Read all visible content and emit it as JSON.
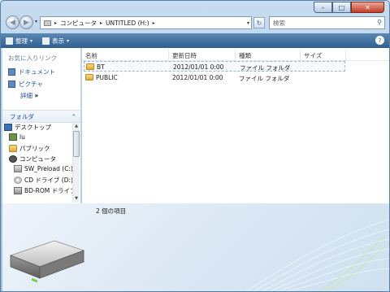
{
  "window": {
    "min_glyph": "–",
    "max_glyph": "□",
    "close_glyph": "✕"
  },
  "nav": {
    "back_glyph": "◀",
    "forward_glyph": "▶",
    "history_glyph": "▾",
    "address": {
      "seg1": "コンピュータ",
      "seg2": "UNTITLED (H:)",
      "sep": "▸",
      "dropdown": "▾"
    },
    "refresh_glyph": "↻",
    "search_placeholder": "検索",
    "search_glyph": "⚲"
  },
  "toolbar": {
    "organize": "整理",
    "views": "表示",
    "arrow": "▾",
    "help": "?"
  },
  "sidebar": {
    "favorites_header": "お気に入りリンク",
    "favorites": [
      "ドキュメント",
      "ピクチャ"
    ],
    "more_label": "詳細",
    "more_glyph": "»",
    "folders_label": "フォルダ",
    "folders_chevron": "⌃",
    "tree": [
      "デスクトップ",
      "lu",
      "パブリック",
      "コンピュータ",
      "SW_Preload (C:)",
      "CD ドライブ (D:)",
      "BD-ROM ドライブ"
    ],
    "scroll_up": "▲",
    "scroll_down": "▼"
  },
  "columns": [
    "名前",
    "更新日時",
    "種類",
    "サイズ"
  ],
  "files": [
    {
      "name": "BT",
      "date": "2012/01/01 0:00",
      "type": "ファイル フォルダ",
      "size": ""
    },
    {
      "name": "PUBLIC",
      "date": "2012/01/01 0:00",
      "type": "ファイル フォルダ",
      "size": ""
    }
  ],
  "details": {
    "count": "2 個の項目"
  },
  "colors": {
    "toolbar": "#2f5f8f",
    "link": "#1d4f9b",
    "address_border": "#7f9db9"
  }
}
